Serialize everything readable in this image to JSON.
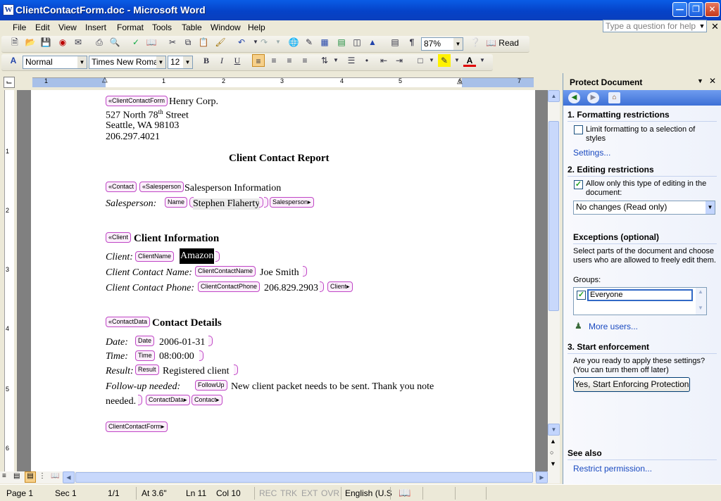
{
  "window": {
    "title": "ClientContactForm.doc - Microsoft Word",
    "app_icon": "W"
  },
  "menu": [
    "File",
    "Edit",
    "View",
    "Insert",
    "Format",
    "Tools",
    "Table",
    "Window",
    "Help"
  ],
  "help_box": {
    "placeholder": "Type a question for help"
  },
  "standard_toolbar": {
    "zoom": "87%",
    "read_label": "Read"
  },
  "formatting_toolbar": {
    "style": "Normal",
    "font": "Times New Roman",
    "size": "12"
  },
  "ruler": {
    "h_numbers": [
      "1",
      "1",
      "2",
      "3",
      "4",
      "5",
      "6",
      "7"
    ],
    "v_numbers": [
      "1",
      "2",
      "3",
      "4",
      "5",
      "6"
    ]
  },
  "document": {
    "company": "Henry Corp.",
    "address1_pre": "527 North 78",
    "address1_sup": "th",
    "address1_post": " Street",
    "address2": "Seattle, WA  98103",
    "phone": "206.297.4021",
    "report_title": "Client Contact Report",
    "salesperson_heading": "Salesperson Information",
    "salesperson_label": "Salesperson:",
    "salesperson_name": "Stephen Flaherty",
    "client_heading": "Client Information",
    "client_label": "Client:",
    "client_value": "Amazon",
    "contact_name_label": "Client Contact Name:",
    "contact_name_value": "Joe Smith",
    "contact_phone_label": "Client Contact Phone:",
    "contact_phone_value": "206.829.2903",
    "details_heading": "Contact Details",
    "date_label": "Date:",
    "date_value": "2006-01-31",
    "time_label": "Time:",
    "time_value": "08:00:00",
    "result_label": "Result:",
    "result_value": "Registered client",
    "followup_label": "Follow-up needed:",
    "followup_value_line1": "New client packet needs to be sent.   Thank you note",
    "followup_value_line2": "needed."
  },
  "xml_tags": {
    "client_contact_form": "ClientContactForm",
    "contact": "Contact",
    "salesperson": "Salesperson",
    "name": "Name",
    "client": "Client",
    "client_name": "ClientName",
    "client_contact_name": "ClientContactName",
    "client_contact_phone": "ClientContactPhone",
    "contact_data": "ContactData",
    "date": "Date",
    "time": "Time",
    "result": "Result",
    "follow_up": "FollowUp"
  },
  "task_pane": {
    "title": "Protect Document",
    "section1_title": "1. Formatting restrictions",
    "limit_formatting": "Limit formatting to a selection of styles",
    "limit_formatting_checked": false,
    "settings_link": "Settings...",
    "section2_title": "2. Editing restrictions",
    "allow_only": "Allow only this type of editing in the document:",
    "allow_only_checked": true,
    "editing_type": "No changes (Read only)",
    "exceptions_title": "Exceptions (optional)",
    "exceptions_text": "Select parts of the document and choose users who are allowed to freely edit them.",
    "groups_label": "Groups:",
    "group_everyone": "Everyone",
    "group_everyone_checked": true,
    "more_users_link": "More users...",
    "section3_title": "3. Start enforcement",
    "enforcement_text": "Are you ready to apply these settings? (You can turn them off later)",
    "enforce_button": "Yes, Start Enforcing Protection",
    "see_also_title": "See also",
    "restrict_permission_link": "Restrict permission..."
  },
  "status_bar": {
    "page": "Page  1",
    "sec": "Sec  1",
    "pages": "1/1",
    "at": "At  3.6\"",
    "ln": "Ln  11",
    "col": "Col  10",
    "rec": "REC",
    "trk": "TRK",
    "ext": "EXT",
    "ovr": "OVR",
    "language": "English (U.S"
  },
  "colors": {
    "title_bar": "#0542c8",
    "xml_tag_border": "#c046c6",
    "xml_tag_fill": "#fbeefb",
    "link": "#1a4ac0",
    "highlight": "#000000"
  }
}
